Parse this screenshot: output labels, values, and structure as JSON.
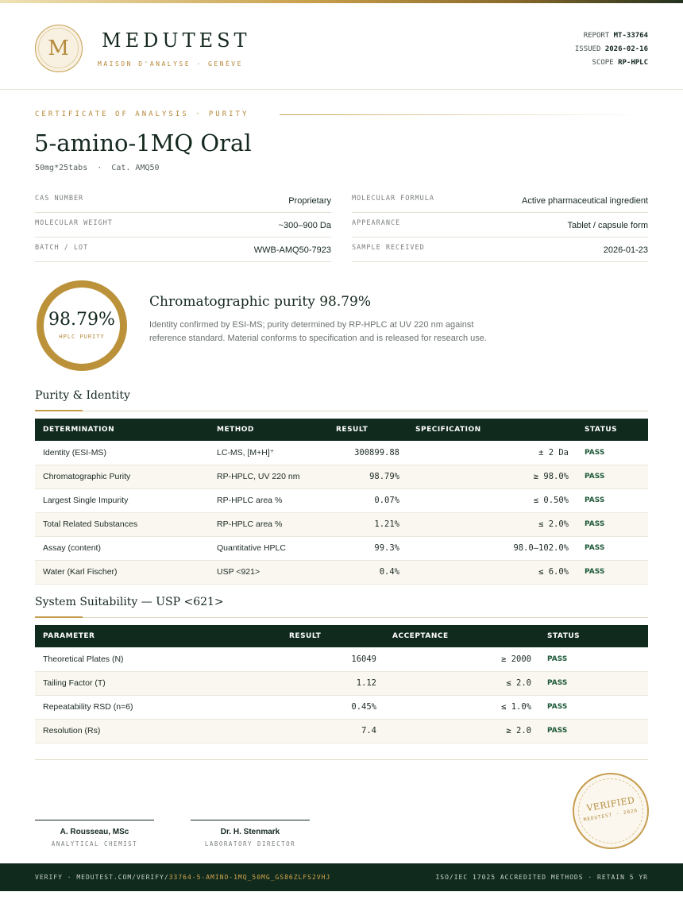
{
  "header": {
    "logo_letter": "M",
    "brand": "MEDUTEST",
    "tagline": "MAISON D'ANALYSE · GENÈVE",
    "report_label": "REPORT",
    "report_value": "MT-33764",
    "issued_label": "ISSUED",
    "issued_value": "2026-02-16",
    "scope_label": "SCOPE",
    "scope_value": "RP-HPLC"
  },
  "certificate": {
    "label": "CERTIFICATE OF ANALYSIS · PURITY",
    "product": "5-amino-1MQ Oral",
    "subtitle": "50mg*25tabs  ·  Cat. AMQ50"
  },
  "info_left": [
    {
      "key": "CAS NUMBER",
      "value": "Proprietary"
    },
    {
      "key": "MOLECULAR WEIGHT",
      "value": "~300–900 Da"
    },
    {
      "key": "BATCH / LOT",
      "value": "WWB-AMQ50-7923"
    }
  ],
  "info_right": [
    {
      "key": "MOLECULAR FORMULA",
      "value": "Active pharmaceutical ingredient"
    },
    {
      "key": "APPEARANCE",
      "value": "Tablet / capsule form"
    },
    {
      "key": "SAMPLE RECEIVED",
      "value": "2026-01-23"
    }
  ],
  "purity": {
    "value": "98.79%",
    "label": "HPLC PURITY",
    "title": "Chromatographic purity 98.79%",
    "description": "Identity confirmed by ESI-MS; purity determined by RP-HPLC at UV 220 nm against reference standard. Material conforms to specification and is released for research use."
  },
  "purity_section": {
    "title": "Purity & Identity",
    "headers": [
      "DETERMINATION",
      "METHOD",
      "RESULT",
      "SPECIFICATION",
      "STATUS"
    ],
    "rows": [
      {
        "determination": "Identity (ESI-MS)",
        "method": "LC-MS, [M+H]⁺",
        "result": "300899.88",
        "spec": "± 2 Da",
        "status": "PASS"
      },
      {
        "determination": "Chromatographic Purity",
        "method": "RP-HPLC, UV 220 nm",
        "result": "98.79%",
        "spec": "≥ 98.0%",
        "status": "PASS"
      },
      {
        "determination": "Largest Single Impurity",
        "method": "RP-HPLC area %",
        "result": "0.07%",
        "spec": "≤ 0.50%",
        "status": "PASS"
      },
      {
        "determination": "Total Related Substances",
        "method": "RP-HPLC area %",
        "result": "1.21%",
        "spec": "≤ 2.0%",
        "status": "PASS"
      },
      {
        "determination": "Assay (content)",
        "method": "Quantitative HPLC",
        "result": "99.3%",
        "spec": "98.0–102.0%",
        "status": "PASS"
      },
      {
        "determination": "Water (Karl Fischer)",
        "method": "USP <921>",
        "result": "0.4%",
        "spec": "≤ 6.0%",
        "status": "PASS"
      }
    ]
  },
  "system_section": {
    "title": "System Suitability — USP <621>",
    "headers": [
      "PARAMETER",
      "RESULT",
      "ACCEPTANCE",
      "STATUS"
    ],
    "rows": [
      {
        "parameter": "Theoretical Plates (N)",
        "result": "16049",
        "acceptance": "≥ 2000",
        "status": "PASS"
      },
      {
        "parameter": "Tailing Factor (T)",
        "result": "1.12",
        "acceptance": "≤ 2.0",
        "status": "PASS"
      },
      {
        "parameter": "Repeatability RSD (n=6)",
        "result": "0.45%",
        "acceptance": "≤ 1.0%",
        "status": "PASS"
      },
      {
        "parameter": "Resolution (Rs)",
        "result": "7.4",
        "acceptance": "≥ 2.0",
        "status": "PASS"
      }
    ]
  },
  "signatures": [
    {
      "name": "A. Rousseau, MSc",
      "role": "ANALYTICAL CHEMIST"
    },
    {
      "name": "Dr. H. Stenmark",
      "role": "LABORATORY DIRECTOR"
    }
  ],
  "seal": {
    "text": "VERIFIED",
    "sub": "MEDUTEST · 2026"
  },
  "footer": {
    "verify_prefix": "VERIFY · MEDUTEST.COM/VERIFY/",
    "verify_code": "33764-5-AMINO-1MQ_50MG_GS86ZLFS2VHJ",
    "accreditation": "ISO/IEC 17025 ACCREDITED METHODS · RETAIN 5 YR"
  },
  "colors": {
    "brand_dark": "#102a1e",
    "gold": "#c69d4f",
    "pass_green": "#1f5a39"
  }
}
